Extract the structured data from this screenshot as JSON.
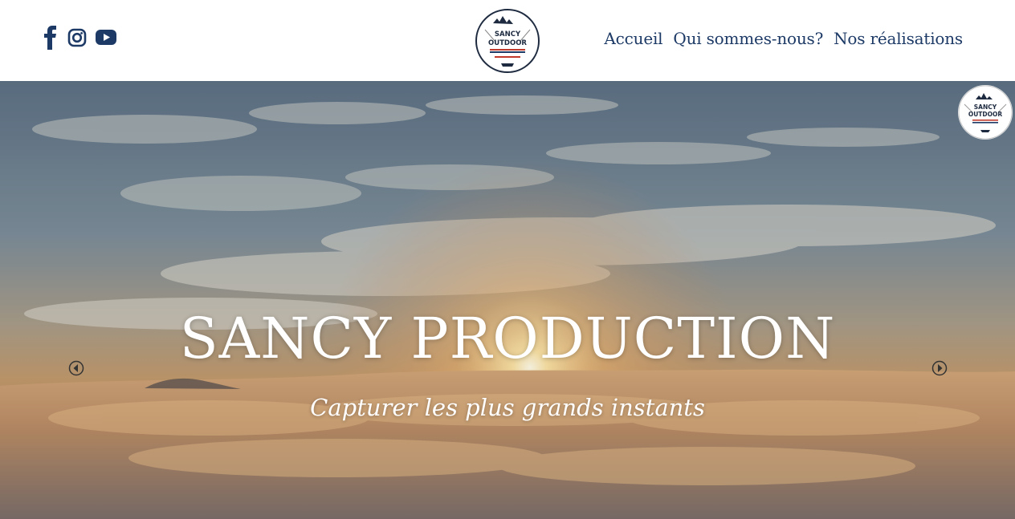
{
  "header": {
    "social": [
      {
        "name": "facebook-icon",
        "color": "#1d3a66"
      },
      {
        "name": "instagram-icon",
        "color": "#1d3a66"
      },
      {
        "name": "youtube-icon",
        "color": "#1d3a66"
      }
    ],
    "logo": {
      "line1": "SANCY",
      "line2": "OUTDOOR"
    },
    "nav": [
      {
        "label": "Accueil"
      },
      {
        "label": "Qui sommes-nous?"
      },
      {
        "label": "Nos réalisations"
      }
    ]
  },
  "hero": {
    "title": "SANCY PRODUCTION",
    "subtitle": "Capturer les plus grands instants",
    "prev_icon": "arrow-left-circle-icon",
    "next_icon": "arrow-right-circle-icon",
    "badge": {
      "line1": "SANCY",
      "line2": "OUTDOOR"
    }
  },
  "colors": {
    "accent": "#1d3a66",
    "badge_red": "#c0392b"
  }
}
